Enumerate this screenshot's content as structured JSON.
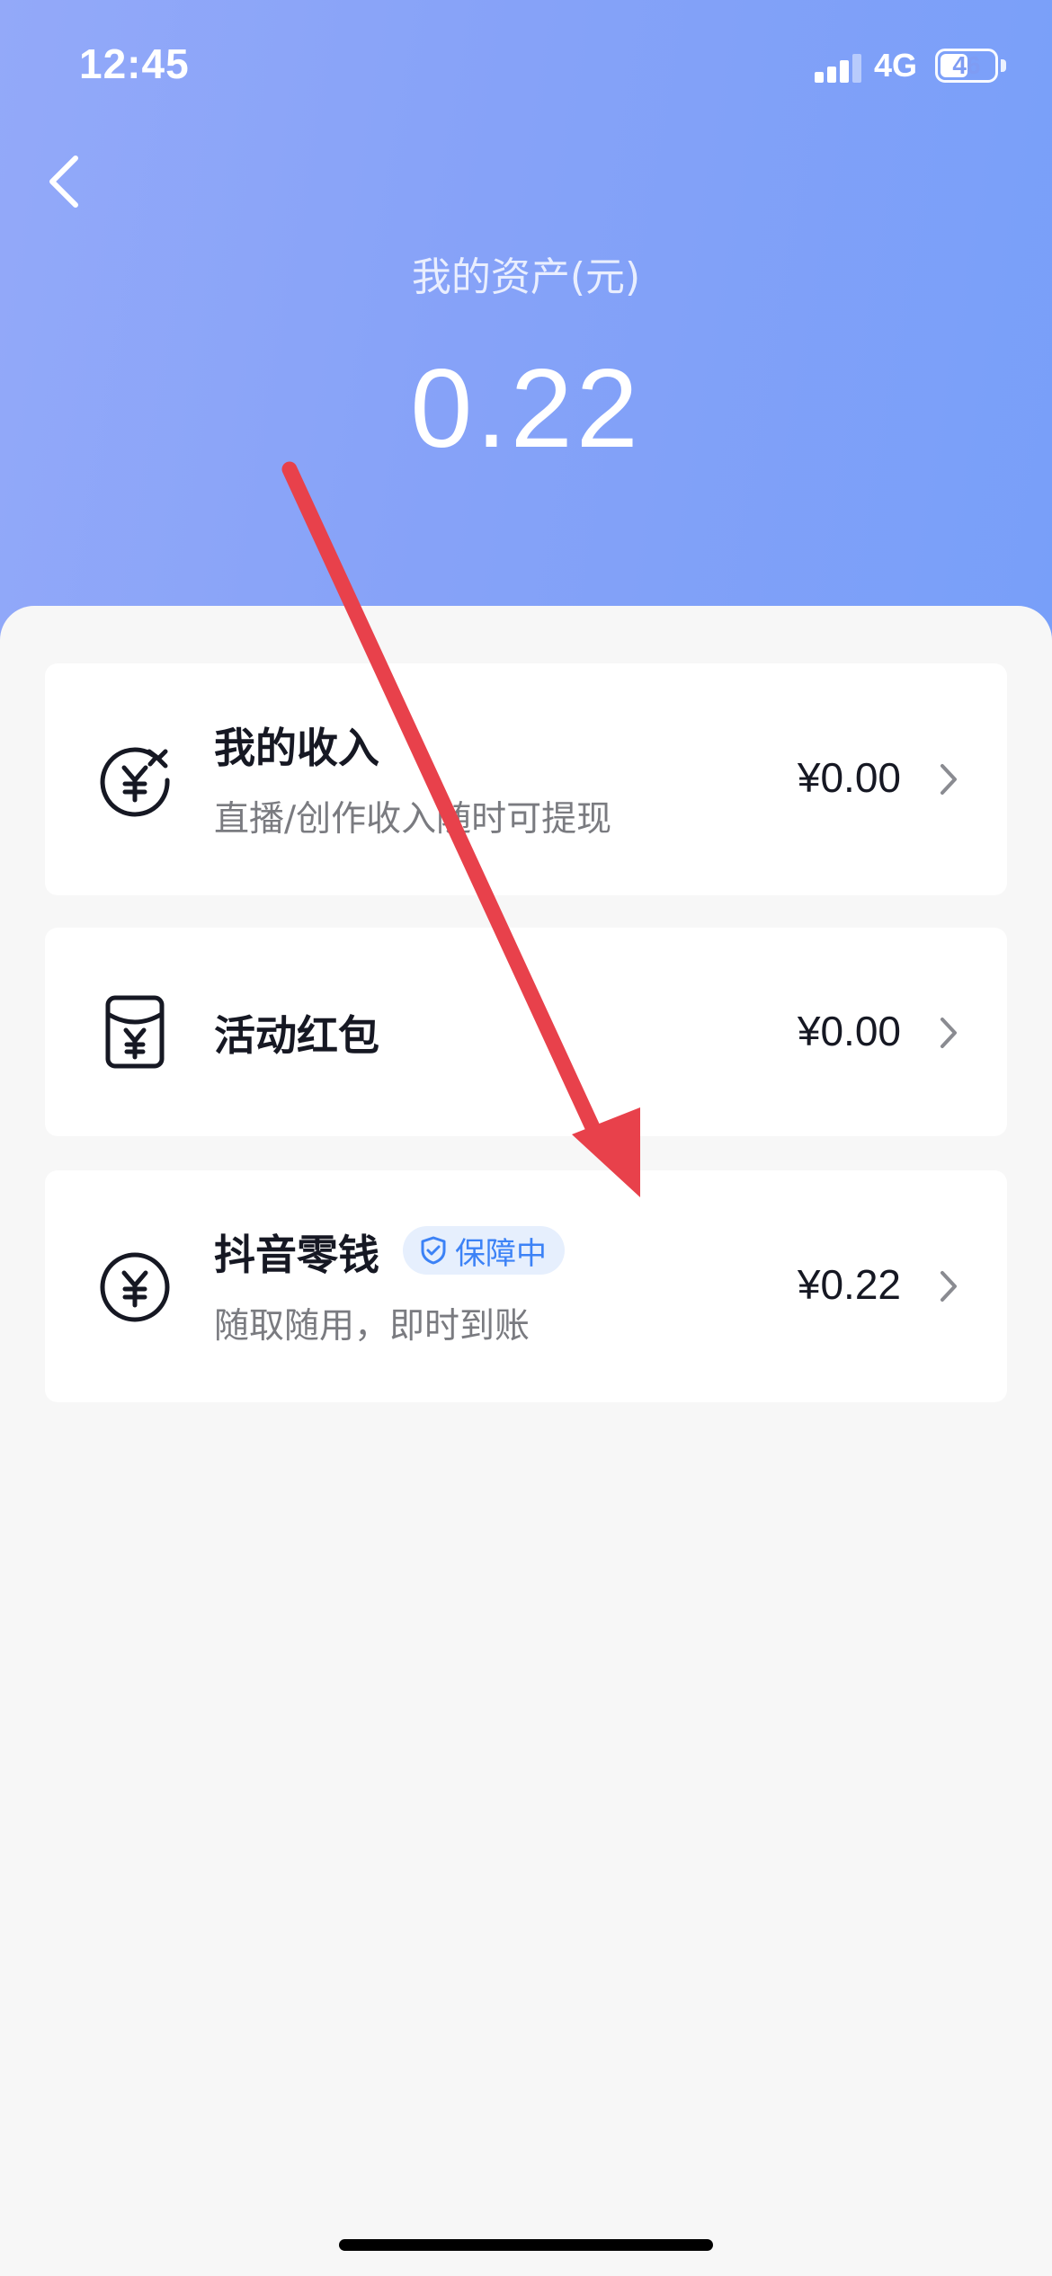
{
  "status_bar": {
    "time": "12:45",
    "network": "4G",
    "battery": "46"
  },
  "header": {
    "back_icon": "chevron-left-icon",
    "title": "我的资产(元)",
    "total_amount": "0.22"
  },
  "cards": [
    {
      "icon": "income-yuan-icon",
      "title": "我的收入",
      "subtitle": "直播/创作收入随时可提现",
      "amount": "¥0.00"
    },
    {
      "icon": "red-packet-icon",
      "title": "活动红包",
      "amount": "¥0.00"
    },
    {
      "icon": "yuan-coin-icon",
      "title": "抖音零钱",
      "badge": "保障中",
      "badge_icon": "shield-check-icon",
      "subtitle": "随取随用，即时到账",
      "amount": "¥0.22"
    }
  ],
  "colors": {
    "header_gradient_start": "#93a9f9",
    "header_gradient_end": "#789ff9",
    "badge_blue": "#3c82f6",
    "annotation_red": "#e8414b"
  }
}
